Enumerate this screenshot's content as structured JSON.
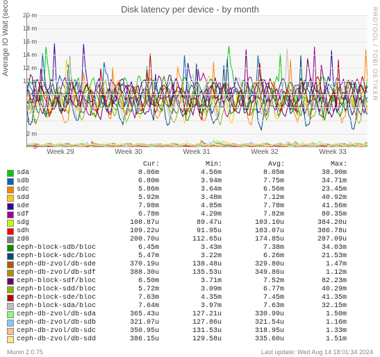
{
  "chart_data": {
    "type": "line",
    "title": "Disk latency per device - by month",
    "ylabel": "Average IO Wait (seconds)",
    "ylim": [
      0,
      0.02
    ],
    "yticks": [
      "0",
      "2 m",
      "4 m",
      "6 m",
      "8 m",
      "10 m",
      "12 m",
      "14 m",
      "16 m",
      "18 m",
      "20 m"
    ],
    "xticks": [
      "Week 29",
      "Week 30",
      "Week 31",
      "Week 32",
      "Week 33"
    ],
    "stat_headers": [
      "Cur:",
      "Min:",
      "Avg:",
      "Max:"
    ],
    "series": [
      {
        "name": "sda",
        "color": "#00cc00",
        "cur": "8.06m",
        "min": "4.56m",
        "avg": "8.05m",
        "max": "38.90m"
      },
      {
        "name": "sdb",
        "color": "#0066b3",
        "cur": "6.80m",
        "min": "3.94m",
        "avg": "7.75m",
        "max": "34.71m"
      },
      {
        "name": "sdc",
        "color": "#ff8000",
        "cur": "5.86m",
        "min": "3.64m",
        "avg": "6.56m",
        "max": "23.45m"
      },
      {
        "name": "sdd",
        "color": "#ffcc00",
        "cur": "5.92m",
        "min": "3.48m",
        "avg": "7.12m",
        "max": "40.92m"
      },
      {
        "name": "sde",
        "color": "#330099",
        "cur": "7.98m",
        "min": "4.85m",
        "avg": "7.78m",
        "max": "41.56m"
      },
      {
        "name": "sdf",
        "color": "#990099",
        "cur": "6.78m",
        "min": "4.20m",
        "avg": "7.82m",
        "max": "80.35m"
      },
      {
        "name": "sdg",
        "color": "#ccff00",
        "cur": "108.87u",
        "min": "89.47u",
        "avg": "103.10u",
        "max": "384.20u"
      },
      {
        "name": "sdh",
        "color": "#ff0000",
        "cur": "109.22u",
        "min": "91.95u",
        "avg": "103.07u",
        "max": "386.78u"
      },
      {
        "name": "zd0",
        "color": "#808080",
        "cur": "200.70u",
        "min": "112.65u",
        "avg": "174.85u",
        "max": "287.09u"
      },
      {
        "name": "ceph-block-sdb/block-sdb",
        "color": "#008f00",
        "cur": "6.45m",
        "min": "3.43m",
        "avg": "7.38m",
        "max": "34.03m"
      },
      {
        "name": "ceph-block-sdc/block-sdc",
        "color": "#00487d",
        "cur": "5.47m",
        "min": "3.22m",
        "avg": "6.26m",
        "max": "21.53m"
      },
      {
        "name": "ceph-db-zvol/db-sde",
        "color": "#b35a00",
        "cur": "370.19u",
        "min": "138.48u",
        "avg": "329.80u",
        "max": "1.47m"
      },
      {
        "name": "ceph-db-zvol/db-sdf",
        "color": "#b38f00",
        "cur": "388.30u",
        "min": "135.53u",
        "avg": "349.86u",
        "max": "1.12m"
      },
      {
        "name": "ceph-block-sdf/block-sdf",
        "color": "#6b006b",
        "cur": "6.50m",
        "min": "3.71m",
        "avg": "7.52m",
        "max": "82.23m"
      },
      {
        "name": "ceph-block-sdd/block-sdd",
        "color": "#8fb300",
        "cur": "5.72m",
        "min": "3.09m",
        "avg": "6.77m",
        "max": "40.29m"
      },
      {
        "name": "ceph-block-sde/block-sde",
        "color": "#b30000",
        "cur": "7.63m",
        "min": "4.35m",
        "avg": "7.45m",
        "max": "41.35m"
      },
      {
        "name": "ceph-block-sda/block-sda",
        "color": "#bebebe",
        "cur": "7.64m",
        "min": "3.97m",
        "avg": "7.63m",
        "max": "32.15m"
      },
      {
        "name": "ceph-db-zvol/db-sda",
        "color": "#80ff80",
        "cur": "365.43u",
        "min": "127.21u",
        "avg": "330.99u",
        "max": "1.50m"
      },
      {
        "name": "ceph-db-zvol/db-sdb",
        "color": "#80c9ff",
        "cur": "321.07u",
        "min": "127.86u",
        "avg": "321.54u",
        "max": "1.16m"
      },
      {
        "name": "ceph-db-zvol/db-sdc",
        "color": "#ffc080",
        "cur": "350.95u",
        "min": "131.53u",
        "avg": "318.95u",
        "max": "1.33m"
      },
      {
        "name": "ceph-db-zvol/db-sdd",
        "color": "#ffe680",
        "cur": "386.15u",
        "min": "129.58u",
        "avg": "335.60u",
        "max": "1.51m"
      }
    ]
  },
  "footer": {
    "tool": "Munin 2.0.75",
    "update": "Last update: Wed Aug 14 18:01:34 2024",
    "watermark": "RRDTOOL / TOBI OETIKER"
  }
}
